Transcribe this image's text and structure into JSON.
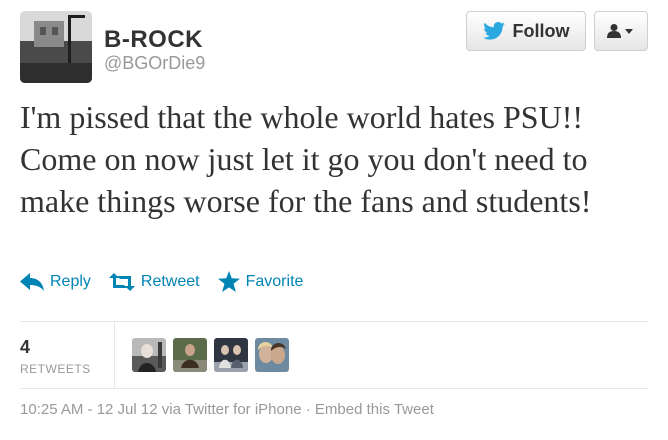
{
  "user": {
    "name": "B-ROCK",
    "handle": "@BGOrDie9"
  },
  "header": {
    "follow_label": "Follow",
    "follow_icon": "bird-icon",
    "menu_icon": "user-dropdown-icon"
  },
  "tweet": {
    "text": "I'm pissed that the whole world hates PSU!! Come on now just let it go you don't need to make things worse for the fans and students!"
  },
  "actions": {
    "reply_label": "Reply",
    "retweet_label": "Retweet",
    "favorite_label": "Favorite"
  },
  "stats": {
    "retweet_count": "4",
    "retweets_label": "RETWEETS",
    "retweeter_count": 4
  },
  "meta": {
    "timestamp": "10:25 AM - 12 Jul 12",
    "via": "via Twitter for iPhone",
    "separator": "·",
    "embed_label": "Embed this Tweet"
  },
  "colors": {
    "link": "#0084b4",
    "text": "#333333",
    "muted": "#999999"
  }
}
